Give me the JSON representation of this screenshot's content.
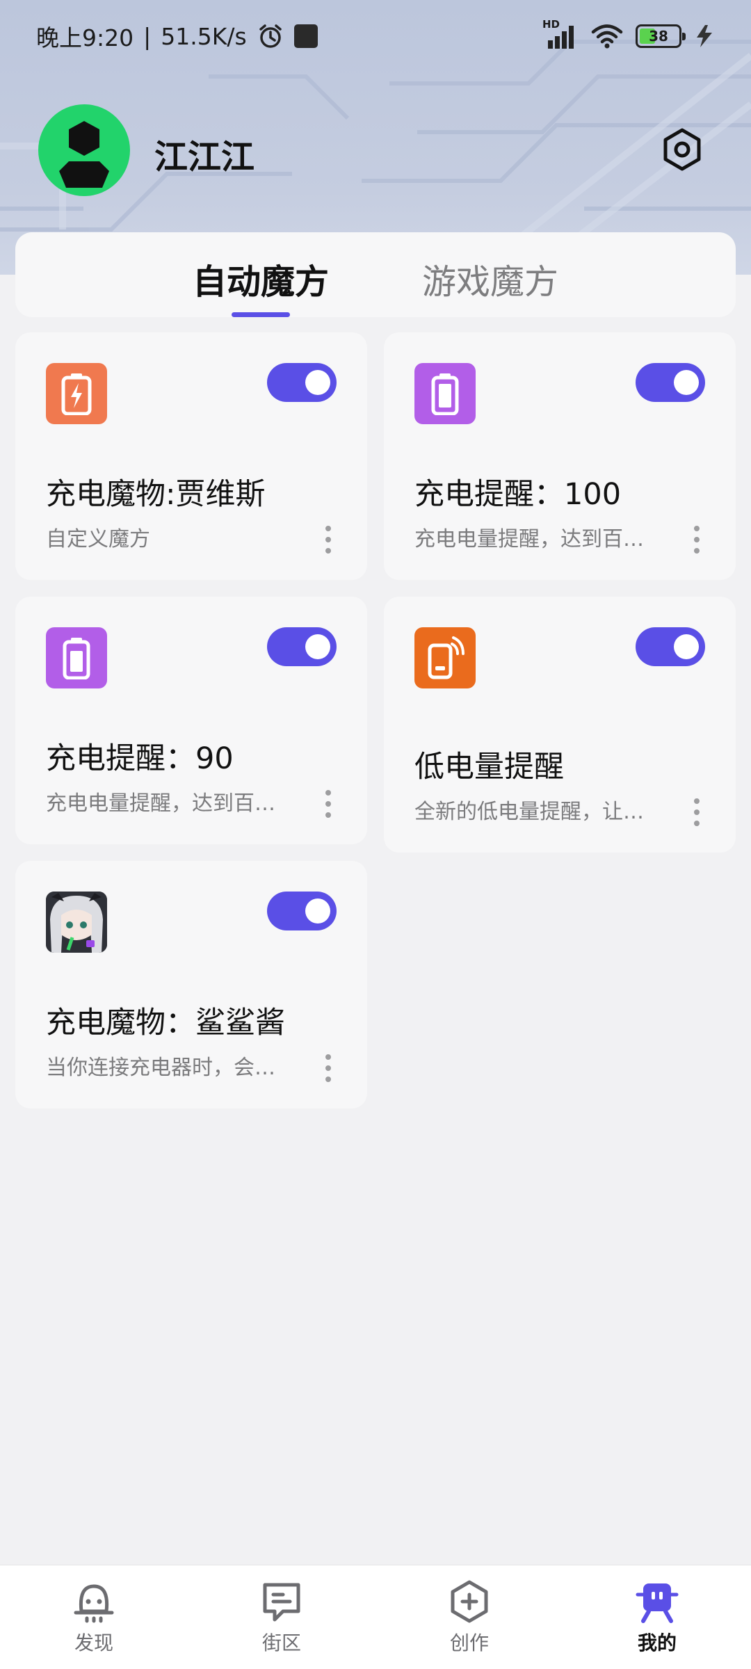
{
  "status_bar": {
    "time": "晚上9:20",
    "separator": "|",
    "net_speed": "51.5K/s",
    "battery_level": "38",
    "signal_label": "HD"
  },
  "profile": {
    "username": "江江江"
  },
  "tabs": [
    {
      "label": "自动魔方",
      "active": true
    },
    {
      "label": "游戏魔方",
      "active": false
    }
  ],
  "cards": [
    {
      "title": "充电魔物:贾维斯",
      "description": "自定义魔方",
      "icon": "charging-battery-icon",
      "enabled": true
    },
    {
      "title": "充电提醒：100",
      "description": "充电电量提醒，达到百…",
      "icon": "battery-icon",
      "enabled": true
    },
    {
      "title": "充电提醒：90",
      "description": "充电电量提醒，达到百…",
      "icon": "battery-icon",
      "enabled": true
    },
    {
      "title": "低电量提醒",
      "description": "全新的低电量提醒，让…",
      "icon": "phone-alert-icon",
      "enabled": true
    },
    {
      "title": "充电魔物：鲨鲨酱",
      "description": "当你连接充电器时，会…",
      "icon": "anime-avatar-icon",
      "enabled": true
    }
  ],
  "bottom_nav": [
    {
      "label": "发现",
      "icon": "discover-icon",
      "active": false
    },
    {
      "label": "街区",
      "icon": "community-icon",
      "active": false
    },
    {
      "label": "创作",
      "icon": "create-icon",
      "active": false
    },
    {
      "label": "我的",
      "icon": "profile-robot-icon",
      "active": true
    }
  ],
  "colors": {
    "accent": "#5a4fe6",
    "orange_icon": "#f0794f",
    "purple_icon": "#b25ee8",
    "deep_orange_icon": "#ea6b1d",
    "avatar_green": "#22d36b"
  }
}
